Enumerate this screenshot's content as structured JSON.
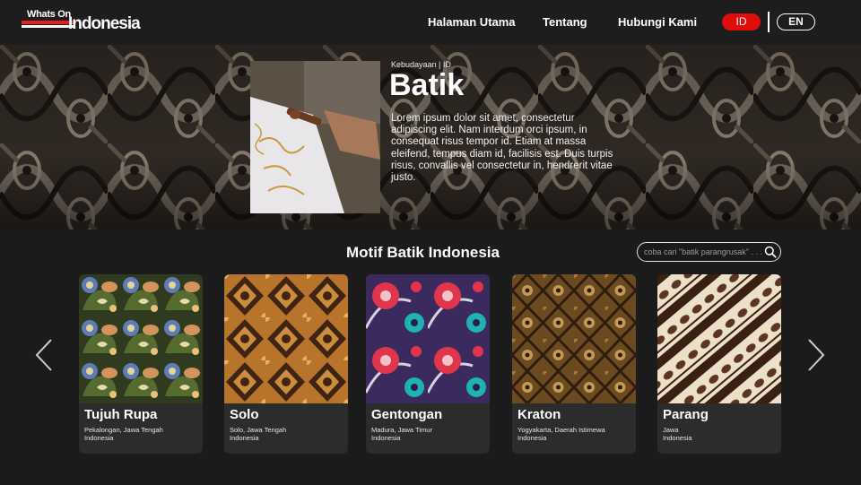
{
  "header": {
    "logo_small": "Whats On",
    "logo_big": "Indonesia",
    "nav": [
      {
        "label": "Halaman Utama"
      },
      {
        "label": "Tentang"
      },
      {
        "label": "Hubungi Kami"
      }
    ],
    "languages": [
      {
        "label": "ID",
        "active": true
      },
      {
        "label": "EN",
        "active": false
      }
    ],
    "accent_color": "#e00d0d"
  },
  "hero": {
    "category": "Kebudayaan | ID",
    "title": "Batik",
    "description": "Lorem ipsum dolor sit amet, consectetur adipiscing elit. Nam interdum orci ipsum, in consequat risus tempor id. Etiam at massa eleifend, tempus diam id, facilisis est. Duis turpis risus, convallis vel consectetur in, hendrerit vitae justo."
  },
  "section": {
    "title": "Motif Batik Indonesia",
    "search_placeholder": "coba cari \"batik parangrusak\" . . ."
  },
  "cards": [
    {
      "name": "Tujuh Rupa",
      "region": "Pekalongan, Jawa Tengah",
      "country": "Indonesia"
    },
    {
      "name": "Solo",
      "region": "Solo, Jawa Tengah",
      "country": "Indonesia"
    },
    {
      "name": "Gentongan",
      "region": "Madura, Jawa Timur",
      "country": "Indonesia"
    },
    {
      "name": "Kraton",
      "region": "Yogyakarta, Daerah Istimewa",
      "country": "Indonesia"
    },
    {
      "name": "Parang",
      "region": "Jawa",
      "country": "Indonesia"
    }
  ]
}
